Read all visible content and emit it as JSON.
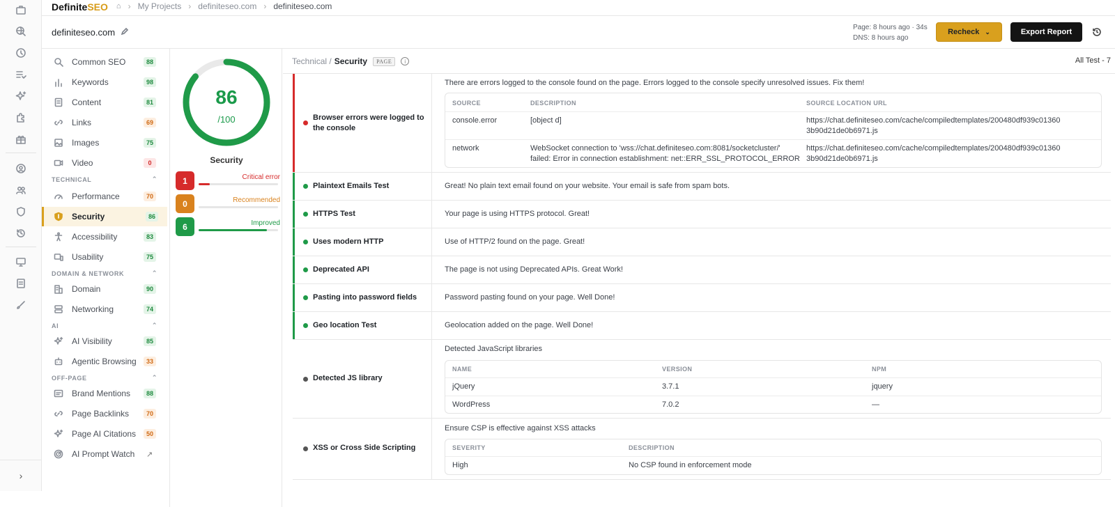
{
  "brand": {
    "name_main": "Definite",
    "name_accent": "SEO"
  },
  "breadcrumb": {
    "projects": "My Projects",
    "domain": "definiteseo.com",
    "current": "definiteseo.com"
  },
  "header": {
    "site": "definiteseo.com",
    "page_time": "Page: 8 hours ago · 34s",
    "dns_time": "DNS: 8 hours ago",
    "recheck_label": "Recheck",
    "export_label": "Export Report"
  },
  "nav": {
    "items_top": [
      {
        "label": "Common SEO",
        "score": "88",
        "level": "green",
        "icon": "search-icon"
      },
      {
        "label": "Keywords",
        "score": "98",
        "level": "green",
        "icon": "bar-chart-icon"
      },
      {
        "label": "Content",
        "score": "81",
        "level": "green",
        "icon": "document-icon"
      },
      {
        "label": "Links",
        "score": "69",
        "level": "orange",
        "icon": "link-icon"
      },
      {
        "label": "Images",
        "score": "75",
        "level": "green",
        "icon": "image-icon"
      },
      {
        "label": "Video",
        "score": "0",
        "level": "red",
        "icon": "video-icon"
      }
    ],
    "section_technical": "TECHNICAL",
    "items_technical": [
      {
        "label": "Performance",
        "score": "70",
        "level": "orange",
        "icon": "gauge-icon"
      },
      {
        "label": "Security",
        "score": "86",
        "level": "green",
        "icon": "shield-icon"
      },
      {
        "label": "Accessibility",
        "score": "83",
        "level": "green",
        "icon": "accessibility-icon"
      },
      {
        "label": "Usability",
        "score": "75",
        "level": "green",
        "icon": "devices-icon"
      }
    ],
    "section_domain": "DOMAIN & NETWORK",
    "items_domain": [
      {
        "label": "Domain",
        "score": "90",
        "level": "green",
        "icon": "building-icon"
      },
      {
        "label": "Networking",
        "score": "74",
        "level": "green",
        "icon": "server-icon"
      }
    ],
    "section_ai": "AI",
    "items_ai": [
      {
        "label": "AI Visibility",
        "score": "85",
        "level": "green",
        "icon": "sparkle-icon"
      },
      {
        "label": "Agentic Browsing",
        "score": "33",
        "level": "orange",
        "icon": "robot-icon"
      }
    ],
    "section_offpage": "OFF-PAGE",
    "items_offpage": [
      {
        "label": "Brand Mentions",
        "score": "88",
        "level": "green",
        "icon": "mention-icon"
      },
      {
        "label": "Page Backlinks",
        "score": "70",
        "level": "orange",
        "icon": "link-icon"
      },
      {
        "label": "Page AI Citations",
        "score": "50",
        "level": "orange",
        "icon": "sparkle-icon"
      },
      {
        "label": "AI Prompt Watch",
        "score": "",
        "level": "",
        "icon": "radar-icon"
      }
    ]
  },
  "score": {
    "value": "86",
    "denominator": "/100",
    "label": "Security",
    "fraction": 0.86,
    "stats": [
      {
        "count": "1",
        "name": "Critical error",
        "color": "#d62b2b",
        "fraction": 0.14
      },
      {
        "count": "0",
        "name": "Recommended",
        "color": "#d9821e",
        "fraction": 0
      },
      {
        "count": "6",
        "name": "Improved",
        "color": "#1f9a48",
        "fraction": 0.86
      }
    ]
  },
  "main": {
    "crumb_parent": "Technical /",
    "crumb_current": "Security",
    "page_tag": "PAGE",
    "all_test": "All Test - 7",
    "browser_errors": {
      "title": "Browser errors were logged to the console",
      "desc": "There are errors logged to the console found on the page. Errors logged to the console specify unresolved issues. Fix them!",
      "headers": [
        "SOURCE",
        "DESCRIPTION",
        "SOURCE LOCATION URL"
      ],
      "rows": [
        {
          "source": "console.error",
          "description": "[object d]",
          "url1": "https://chat.definiteseo.com/cache/compiledtemplates/200480df939c01360",
          "url2": "3b90d21de0b6971.js"
        },
        {
          "source": "network",
          "description1": "WebSocket connection to 'wss://chat.definiteseo.com:8081/socketcluster/'",
          "description2": "failed: Error in connection establishment: net::ERR_SSL_PROTOCOL_ERROR",
          "url1": "https://chat.definiteseo.com/cache/compiledtemplates/200480df939c01360",
          "url2": "3b90d21de0b6971.js"
        }
      ]
    },
    "tests": [
      {
        "title": "Plaintext Emails Test",
        "desc": "Great! No plain text email found on your website. Your email is safe from spam bots."
      },
      {
        "title": "HTTPS Test",
        "desc": "Your page is using HTTPS protocol. Great!"
      },
      {
        "title": "Uses modern HTTP",
        "desc": "Use of HTTP/2 found on the page. Great!"
      },
      {
        "title": "Deprecated API",
        "desc": "The page is not using Deprecated APIs. Great Work!"
      },
      {
        "title": "Pasting into password fields",
        "desc": "Password pasting found on your page. Well Done!"
      },
      {
        "title": "Geo location Test",
        "desc": "Geolocation added on the page. Well Done!"
      }
    ],
    "js_library": {
      "title": "Detected JS library",
      "desc": "Detected JavaScript libraries",
      "headers": [
        "NAME",
        "VERSION",
        "NPM"
      ],
      "rows": [
        {
          "name": "jQuery",
          "version": "3.7.1",
          "npm": "jquery"
        },
        {
          "name": "WordPress",
          "version": "7.0.2",
          "npm": "—"
        }
      ]
    },
    "xss": {
      "title": "XSS or Cross Side Scripting",
      "desc": "Ensure CSP is effective against XSS attacks",
      "headers": [
        "SEVERITY",
        "DESCRIPTION"
      ],
      "rows": [
        {
          "severity": "High",
          "description": "No CSP found in enforcement mode"
        }
      ]
    }
  }
}
